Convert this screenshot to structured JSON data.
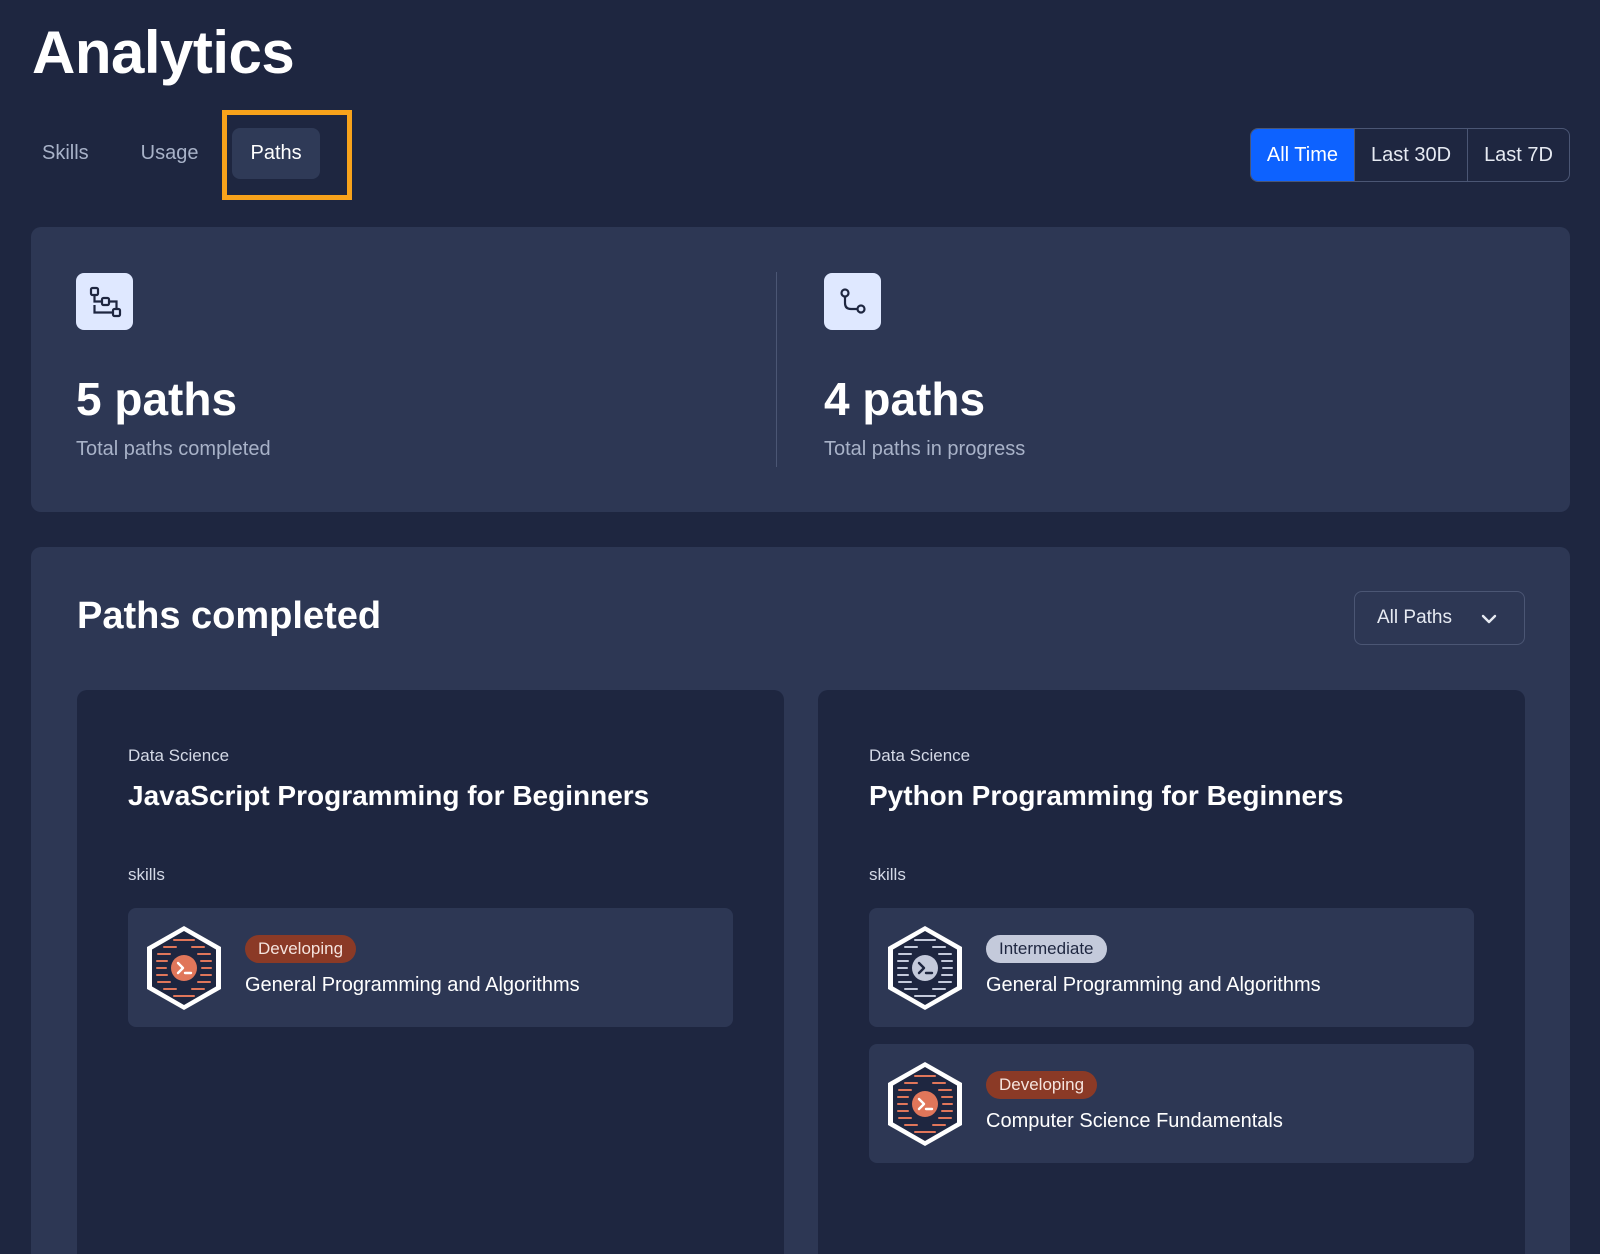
{
  "header": {
    "title": "Analytics"
  },
  "tabs": [
    {
      "label": "Skills"
    },
    {
      "label": "Usage"
    },
    {
      "label": "Paths"
    }
  ],
  "active_tab": "Paths",
  "time_range": {
    "options": [
      {
        "label": "All Time"
      },
      {
        "label": "Last 30D"
      },
      {
        "label": "Last 7D"
      }
    ],
    "selected": "All Time"
  },
  "stats": {
    "completed": {
      "value": "5 paths",
      "label": "Total paths completed",
      "icon": "path-nodes-icon"
    },
    "in_progress": {
      "value": "4 paths",
      "label": "Total paths in progress",
      "icon": "path-branch-icon"
    }
  },
  "paths_completed": {
    "title": "Paths completed",
    "filter": {
      "selected": "All Paths",
      "icon": "chevron-down-icon"
    },
    "cards": [
      {
        "category": "Data Science",
        "title": "JavaScript Programming for Beginners",
        "skills_label": "skills",
        "skills": [
          {
            "level": "Developing",
            "name": "General Programming and Algorithms",
            "icon": "terminal-badge-icon"
          }
        ]
      },
      {
        "category": "Data Science",
        "title": "Python Programming for Beginners",
        "skills_label": "skills",
        "skills": [
          {
            "level": "Intermediate",
            "name": "General Programming and Algorithms",
            "icon": "terminal-badge-icon"
          },
          {
            "level": "Developing",
            "name": "Computer Science Fundamentals",
            "icon": "terminal-badge-icon"
          }
        ]
      }
    ]
  },
  "colors": {
    "background": "#1e2640",
    "card": "#2d3754",
    "accent": "#0d62ff",
    "highlight": "#f7a21b",
    "developing": "#8b3a26",
    "intermediate": "#c4cadb"
  }
}
